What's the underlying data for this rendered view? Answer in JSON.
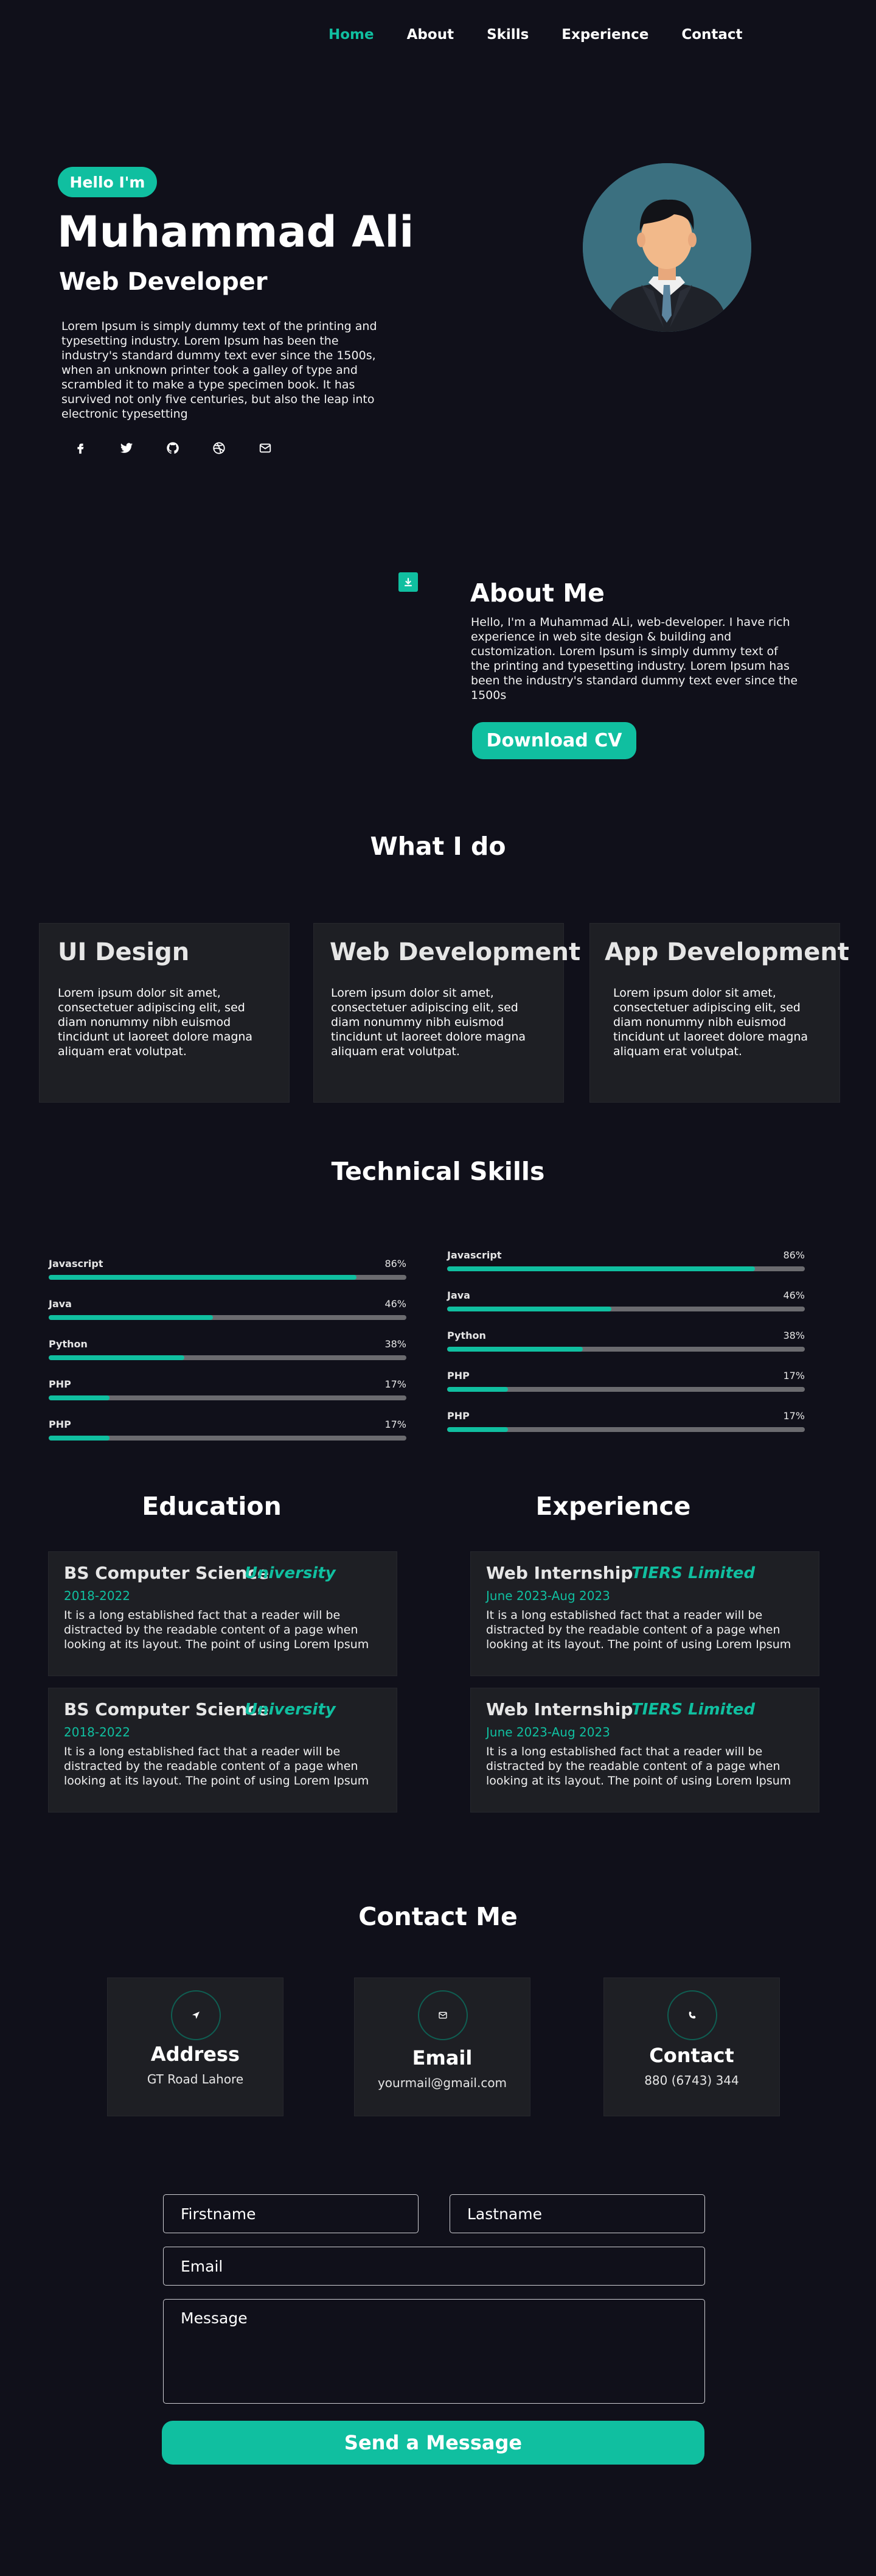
{
  "nav": {
    "items": [
      "Home",
      "About",
      "Skills",
      "Experience",
      "Contact"
    ],
    "active": "Home"
  },
  "hero": {
    "badge": "Hello I'm",
    "name": "Muhammad Ali",
    "role": "Web Developer",
    "text": "Lorem Ipsum is simply dummy text of the printing and typesetting industry. Lorem Ipsum has been the industry's standard dummy text ever since the 1500s, when an unknown printer took a galley of type and scrambled it to make a type specimen book. It has survived not only five centuries, but also the leap into electronic typesetting",
    "social_icons": [
      "facebook-icon",
      "twitter-icon",
      "github-icon",
      "dribbble-icon",
      "mail-icon"
    ]
  },
  "about": {
    "title": "About Me",
    "text": "Hello, I'm a Muhammad ALi, web-developer. I have rich experience in web site design & building and customization. Lorem Ipsum is simply dummy text of the printing and typesetting industry. Lorem Ipsum has been the industry's standard dummy text ever since the 1500s",
    "button": "Download CV"
  },
  "services": {
    "title": "What I do",
    "items": [
      {
        "title": "UI Design",
        "text": "Lorem ipsum dolor sit amet, consectetuer adipiscing elit, sed diam nonummy nibh euismod tincidunt ut laoreet dolore magna aliquam erat volutpat."
      },
      {
        "title": "Web Development",
        "text": "Lorem ipsum dolor sit amet, consectetuer adipiscing elit, sed diam nonummy nibh euismod tincidunt ut laoreet dolore magna aliquam erat volutpat."
      },
      {
        "title": "App Development",
        "text": "Lorem ipsum dolor sit amet, consectetuer adipiscing elit, sed diam nonummy nibh euismod tincidunt ut laoreet dolore magna aliquam erat volutpat."
      }
    ]
  },
  "skills": {
    "title": "Technical Skills",
    "left": [
      {
        "name": "Javascript",
        "pct": "86%",
        "level": 0.86
      },
      {
        "name": "Java",
        "pct": "46%",
        "level": 0.46
      },
      {
        "name": "Python",
        "pct": "38%",
        "level": 0.38
      },
      {
        "name": "PHP",
        "pct": "17%",
        "level": 0.17
      },
      {
        "name": "PHP",
        "pct": "17%",
        "level": 0.17
      }
    ],
    "right": [
      {
        "name": "Javascript",
        "pct": "86%",
        "level": 0.86
      },
      {
        "name": "Java",
        "pct": "46%",
        "level": 0.46
      },
      {
        "name": "Python",
        "pct": "38%",
        "level": 0.38
      },
      {
        "name": "PHP",
        "pct": "17%",
        "level": 0.17
      },
      {
        "name": "PHP",
        "pct": "17%",
        "level": 0.17
      }
    ]
  },
  "education": {
    "title": "Education",
    "items": [
      {
        "heading": "BS Computer Science",
        "tag": "University",
        "date": "2018-2022",
        "text": "It is a long established fact that a reader will be distracted by the readable content of a page when looking at its layout. The point of using Lorem Ipsum"
      },
      {
        "heading": "BS Computer Science",
        "tag": "University",
        "date": "2018-2022",
        "text": "It is a long established fact that a reader will be distracted by the readable content of a page when looking at its layout. The point of using Lorem Ipsum"
      }
    ]
  },
  "experience": {
    "title": "Experience",
    "items": [
      {
        "heading": "Web Internship",
        "tag": "TIERS Limited",
        "date": "June 2023-Aug 2023",
        "text": "It is a long established fact that a reader will be distracted by the readable content of a page when looking at its layout. The point of using Lorem Ipsum"
      },
      {
        "heading": "Web Internship",
        "tag": "TIERS Limited",
        "date": "June 2023-Aug 2023",
        "text": "It is a long established fact that a reader will be distracted by the readable content of a page when looking at its layout. The point of using Lorem Ipsum"
      }
    ]
  },
  "contact": {
    "title": "Contact Me",
    "cards": [
      {
        "icon": "location-arrow-icon",
        "label": "Address",
        "value": "GT Road Lahore"
      },
      {
        "icon": "envelope-icon",
        "label": "Email",
        "value": "yourmail@gmail.com"
      },
      {
        "icon": "phone-icon",
        "label": "Contact",
        "value": "880 (6743) 344"
      }
    ],
    "form": {
      "firstname_placeholder": "Firstname",
      "lastname_placeholder": "Lastname",
      "email_placeholder": "Email",
      "message_placeholder": "Message",
      "submit": "Send a Message"
    }
  },
  "colors": {
    "background": "#10101a",
    "accent": "#10bfa0",
    "card": "#1e1f24",
    "bar_track": "#6b6b6f"
  }
}
